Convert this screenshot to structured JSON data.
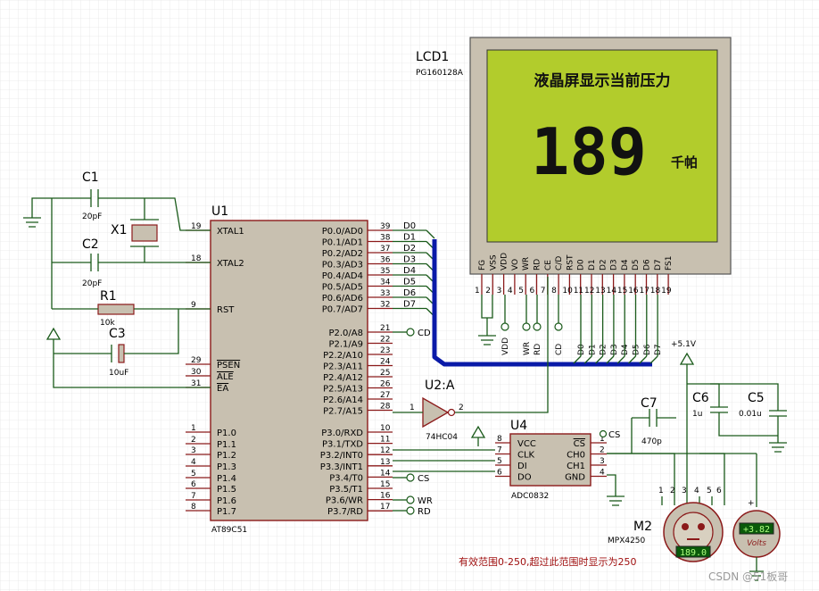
{
  "lcd": {
    "ref": "LCD1",
    "part": "PG160128A",
    "line1": "液晶屏显示当前压力",
    "value": "189",
    "unit": "千帕",
    "pins": [
      "FG",
      "VSS",
      "VDD",
      "VO",
      "WR",
      "RD",
      "CE",
      "C/D",
      "RST",
      "D0",
      "D1",
      "D2",
      "D3",
      "D4",
      "D5",
      "D6",
      "D7",
      "FS1"
    ],
    "pin_numbers": [
      "1",
      "2",
      "3",
      "4",
      "5",
      "6",
      "7",
      "8",
      "10",
      "11",
      "12",
      "13",
      "14",
      "15",
      "16",
      "17",
      "18",
      "19"
    ],
    "bottom_labels": [
      "VDD",
      "WR",
      "RD",
      "CD",
      "D0",
      "D1",
      "D2",
      "D3",
      "D4",
      "D5",
      "D6",
      "D7"
    ]
  },
  "mcu": {
    "ref": "U1",
    "part": "AT89C51",
    "left_pins": [
      {
        "name": "XTAL1",
        "num": "19"
      },
      {
        "name": "XTAL2",
        "num": "18"
      },
      {
        "name": "RST",
        "num": "9"
      },
      {
        "name": "PSEN",
        "num": "29"
      },
      {
        "name": "ALE",
        "num": "30"
      },
      {
        "name": "EA",
        "num": "31"
      },
      {
        "name": "P1.0",
        "num": "1"
      },
      {
        "name": "P1.1",
        "num": "2"
      },
      {
        "name": "P1.2",
        "num": "3"
      },
      {
        "name": "P1.3",
        "num": "4"
      },
      {
        "name": "P1.4",
        "num": "5"
      },
      {
        "name": "P1.5",
        "num": "6"
      },
      {
        "name": "P1.6",
        "num": "7"
      },
      {
        "name": "P1.7",
        "num": "8"
      }
    ],
    "right_pins": [
      {
        "name": "P0.0/AD0",
        "num": "39"
      },
      {
        "name": "P0.1/AD1",
        "num": "38"
      },
      {
        "name": "P0.2/AD2",
        "num": "37"
      },
      {
        "name": "P0.3/AD3",
        "num": "36"
      },
      {
        "name": "P0.4/AD4",
        "num": "35"
      },
      {
        "name": "P0.5/AD5",
        "num": "34"
      },
      {
        "name": "P0.6/AD6",
        "num": "33"
      },
      {
        "name": "P0.7/AD7",
        "num": "32"
      },
      {
        "name": "P2.0/A8",
        "num": "21"
      },
      {
        "name": "P2.1/A9",
        "num": "22"
      },
      {
        "name": "P2.2/A10",
        "num": "23"
      },
      {
        "name": "P2.3/A11",
        "num": "24"
      },
      {
        "name": "P2.4/A12",
        "num": "25"
      },
      {
        "name": "P2.5/A13",
        "num": "26"
      },
      {
        "name": "P2.6/A14",
        "num": "27"
      },
      {
        "name": "P2.7/A15",
        "num": "28"
      },
      {
        "name": "P3.0/RXD",
        "num": "10"
      },
      {
        "name": "P3.1/TXD",
        "num": "11"
      },
      {
        "name": "P3.2/INT0",
        "num": "12"
      },
      {
        "name": "P3.3/INT1",
        "num": "13"
      },
      {
        "name": "P3.4/T0",
        "num": "14"
      },
      {
        "name": "P3.5/T1",
        "num": "15"
      },
      {
        "name": "P3.6/WR",
        "num": "16"
      },
      {
        "name": "P3.7/RD",
        "num": "17"
      }
    ],
    "data_labels": [
      "D0",
      "D1",
      "D2",
      "D3",
      "D4",
      "D5",
      "D6",
      "D7"
    ],
    "net_cd": "CD",
    "net_cs": "CS",
    "net_wr": "WR",
    "net_rd": "RD"
  },
  "c1": {
    "ref": "C1",
    "value": "20pF"
  },
  "c2": {
    "ref": "C2",
    "value": "20pF"
  },
  "x1": {
    "ref": "X1"
  },
  "r1": {
    "ref": "R1",
    "value": "10k"
  },
  "c3": {
    "ref": "C3",
    "value": "10uF"
  },
  "u2": {
    "ref": "U2:A",
    "part": "74HC04",
    "pin_in": "1",
    "pin_out": "2"
  },
  "adc": {
    "ref": "U4",
    "part": "ADC0832",
    "left_pins": [
      {
        "name": "VCC",
        "num": "8"
      },
      {
        "name": "CLK",
        "num": "7"
      },
      {
        "name": "DI",
        "num": "5"
      },
      {
        "name": "DO",
        "num": "6"
      }
    ],
    "right_pins": [
      {
        "name": "CS",
        "num": "1"
      },
      {
        "name": "CH0",
        "num": "2"
      },
      {
        "name": "CH1",
        "num": "3"
      },
      {
        "name": "GND",
        "num": "4"
      }
    ],
    "cs_net": "CS"
  },
  "c7": {
    "ref": "C7",
    "value": "470p"
  },
  "c6": {
    "ref": "C6",
    "value": "1u"
  },
  "c5": {
    "ref": "C5",
    "value": "0.01u"
  },
  "supply": {
    "label": "+5.1V"
  },
  "sensor": {
    "ref": "M2",
    "part": "MPX4250",
    "pins": [
      "1",
      "2",
      "3",
      "4",
      "5",
      "6"
    ],
    "readout": "189.0"
  },
  "voltmeter": {
    "readout": "+3.82",
    "unit": "Volts"
  },
  "note": "有效范围0-250,超过此范围时显示为250",
  "watermark": "CSDN @51板哥",
  "colors": {
    "lcd_screen": "#b2cc2c",
    "lcd_frame": "#c8c0b0",
    "bus": "#0a1aa8",
    "note": "#a01010",
    "readout_bg": "#0a5a0a",
    "readout_fg": "#b0ff80"
  }
}
